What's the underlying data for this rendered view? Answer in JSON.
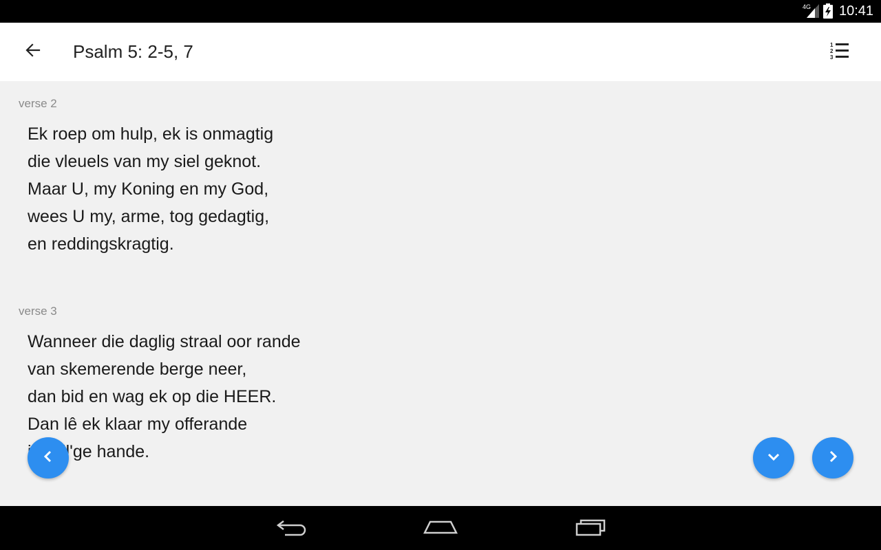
{
  "status_bar": {
    "network": "4G",
    "time": "10:41",
    "icons": [
      "signal-icon",
      "battery-icon"
    ]
  },
  "app_bar": {
    "title": "Psalm 5: 2-5, 7",
    "back_icon": "arrow-back-icon",
    "menu_icon": "numbered-list-icon"
  },
  "verses": [
    {
      "label": "verse 2",
      "lines": [
        "Ek roep om hulp, ek is onmagtig",
        "die vleuels van my siel geknot.",
        "Maar U, my Koning en my God,",
        "wees U my, arme, tog gedagtig,",
        "en reddingskragtig."
      ]
    },
    {
      "label": "verse 3",
      "lines": [
        "Wanneer die daglig straal oor rande",
        "van skemerende berge neer,",
        "dan bid en wag ek op die HEER.",
        "Dan lê ek klaar my offerande",
        "in will'ge hande."
      ]
    }
  ],
  "fabs": {
    "previous_icon": "chevron-left-icon",
    "scroll_down_icon": "chevron-down-icon",
    "next_icon": "chevron-right-icon",
    "color": "#2d8ef0"
  },
  "nav_bar": {
    "icons": [
      "back-nav-icon",
      "home-nav-icon",
      "recents-nav-icon"
    ]
  }
}
